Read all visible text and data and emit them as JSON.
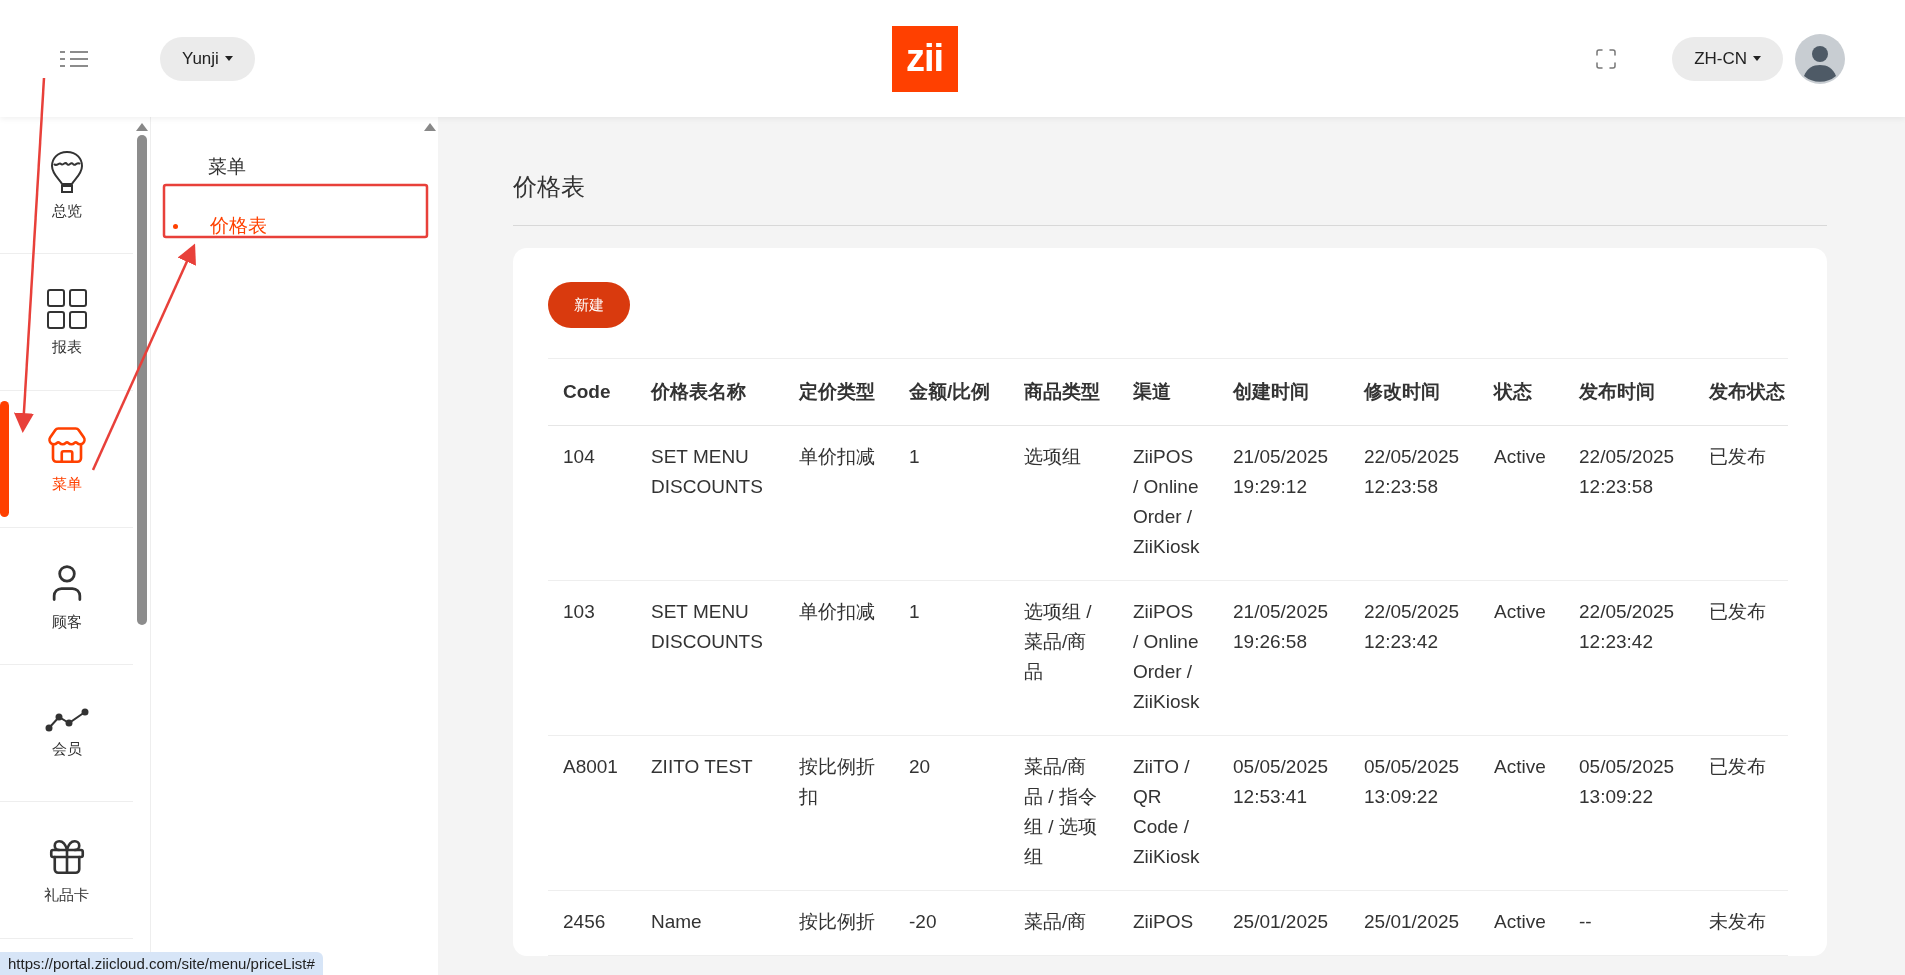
{
  "header": {
    "store": "Yunji",
    "logo": "zii",
    "language": "ZH-CN"
  },
  "nav": [
    {
      "label": "总览",
      "selected": false
    },
    {
      "label": "报表",
      "selected": false
    },
    {
      "label": "菜单",
      "selected": true
    },
    {
      "label": "顾客",
      "selected": false
    },
    {
      "label": "会员",
      "selected": false
    },
    {
      "label": "礼品卡",
      "selected": false
    }
  ],
  "submenu": {
    "group": "菜单",
    "items": [
      {
        "label": "价格表",
        "selected": true
      }
    ]
  },
  "page": {
    "title": "价格表",
    "new_button": "新建"
  },
  "table": {
    "columns": [
      "Code",
      "价格表名称",
      "定价类型",
      "金额/比例",
      "商品类型",
      "渠道",
      "创建时间",
      "修改时间",
      "状态",
      "发布时间",
      "发布状态"
    ],
    "rows": [
      [
        "104",
        "SET MENU DISCOUNTS",
        "单价扣减",
        "1",
        "选项组",
        "ZiiPOS / Online Order / ZiiKiosk",
        "21/05/2025 19:29:12",
        "22/05/2025 12:23:58",
        "Active",
        "22/05/2025 12:23:58",
        "已发布"
      ],
      [
        "103",
        "SET MENU DISCOUNTS",
        "单价扣减",
        "1",
        "选项组 / 菜品/商品",
        "ZiiPOS / Online Order / ZiiKiosk",
        "21/05/2025 19:26:58",
        "22/05/2025 12:23:42",
        "Active",
        "22/05/2025 12:23:42",
        "已发布"
      ],
      [
        "A8001",
        "ZIITO TEST",
        "按比例折扣",
        "20",
        "菜品/商品 / 指令组 / 选项组",
        "ZiiTO / QR Code / ZiiKiosk",
        "05/05/2025 12:53:41",
        "05/05/2025 13:09:22",
        "Active",
        "05/05/2025 13:09:22",
        "已发布"
      ],
      [
        "2456",
        "Name",
        "按比例折",
        "-20",
        "菜品/商",
        "ZiiPOS",
        "25/01/2025",
        "25/01/2025",
        "Active",
        "--",
        "未发布"
      ]
    ]
  },
  "status_url": "https://portal.ziicloud.com/site/menu/priceList#"
}
